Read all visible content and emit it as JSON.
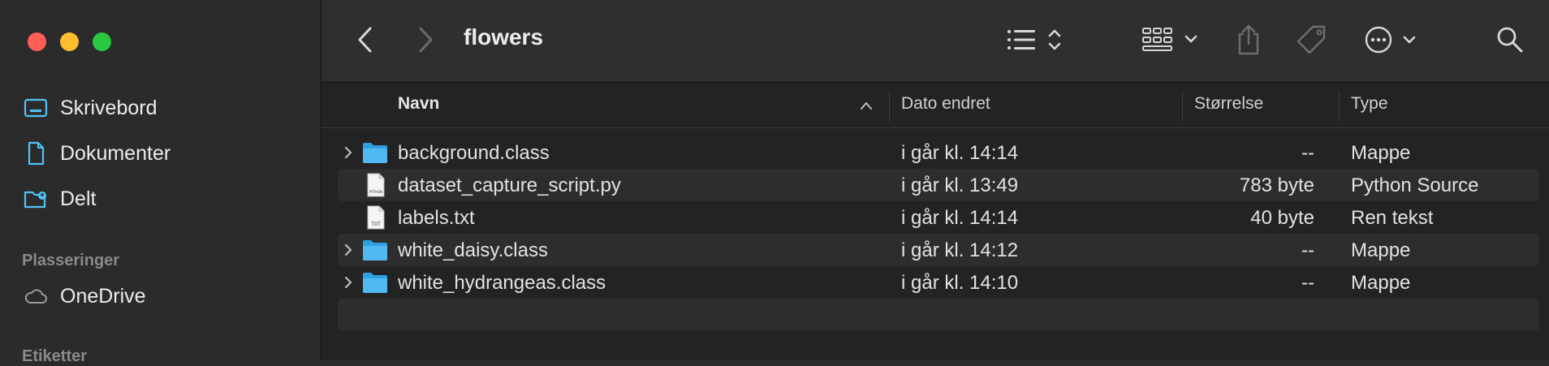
{
  "window": {
    "title": "flowers"
  },
  "sidebar": {
    "favorites": [
      {
        "label": "Skrivebord",
        "icon": "desktop-icon"
      },
      {
        "label": "Dokumenter",
        "icon": "document-icon"
      },
      {
        "label": "Delt",
        "icon": "shared-folder-icon"
      }
    ],
    "locations_heading": "Plasseringer",
    "locations": [
      {
        "label": "OneDrive",
        "icon": "cloud-icon"
      }
    ],
    "tags_heading": "Etiketter"
  },
  "columns": {
    "name": "Navn",
    "modified": "Dato endret",
    "size": "Størrelse",
    "kind": "Type"
  },
  "files": [
    {
      "name": "background.class",
      "modified": "i går kl. 14:14",
      "size": "--",
      "kind": "Mappe",
      "type": "folder"
    },
    {
      "name": "dataset_capture_script.py",
      "modified": "i går kl. 13:49",
      "size": "783 byte",
      "kind": "Python Source",
      "type": "python"
    },
    {
      "name": "labels.txt",
      "modified": "i går kl. 14:14",
      "size": "40 byte",
      "kind": "Ren tekst",
      "type": "text"
    },
    {
      "name": "white_daisy.class",
      "modified": "i går kl. 14:12",
      "size": "--",
      "kind": "Mappe",
      "type": "folder"
    },
    {
      "name": "white_hydrangeas.class",
      "modified": "i går kl. 14:10",
      "size": "--",
      "kind": "Mappe",
      "type": "folder"
    }
  ],
  "file_icon_labels": {
    "python": "PYTHON",
    "text": "TXT"
  },
  "colors": {
    "close": "#ff5f57",
    "minimize": "#febc2e",
    "zoom": "#28c840",
    "accent": "#4fc3f7"
  }
}
